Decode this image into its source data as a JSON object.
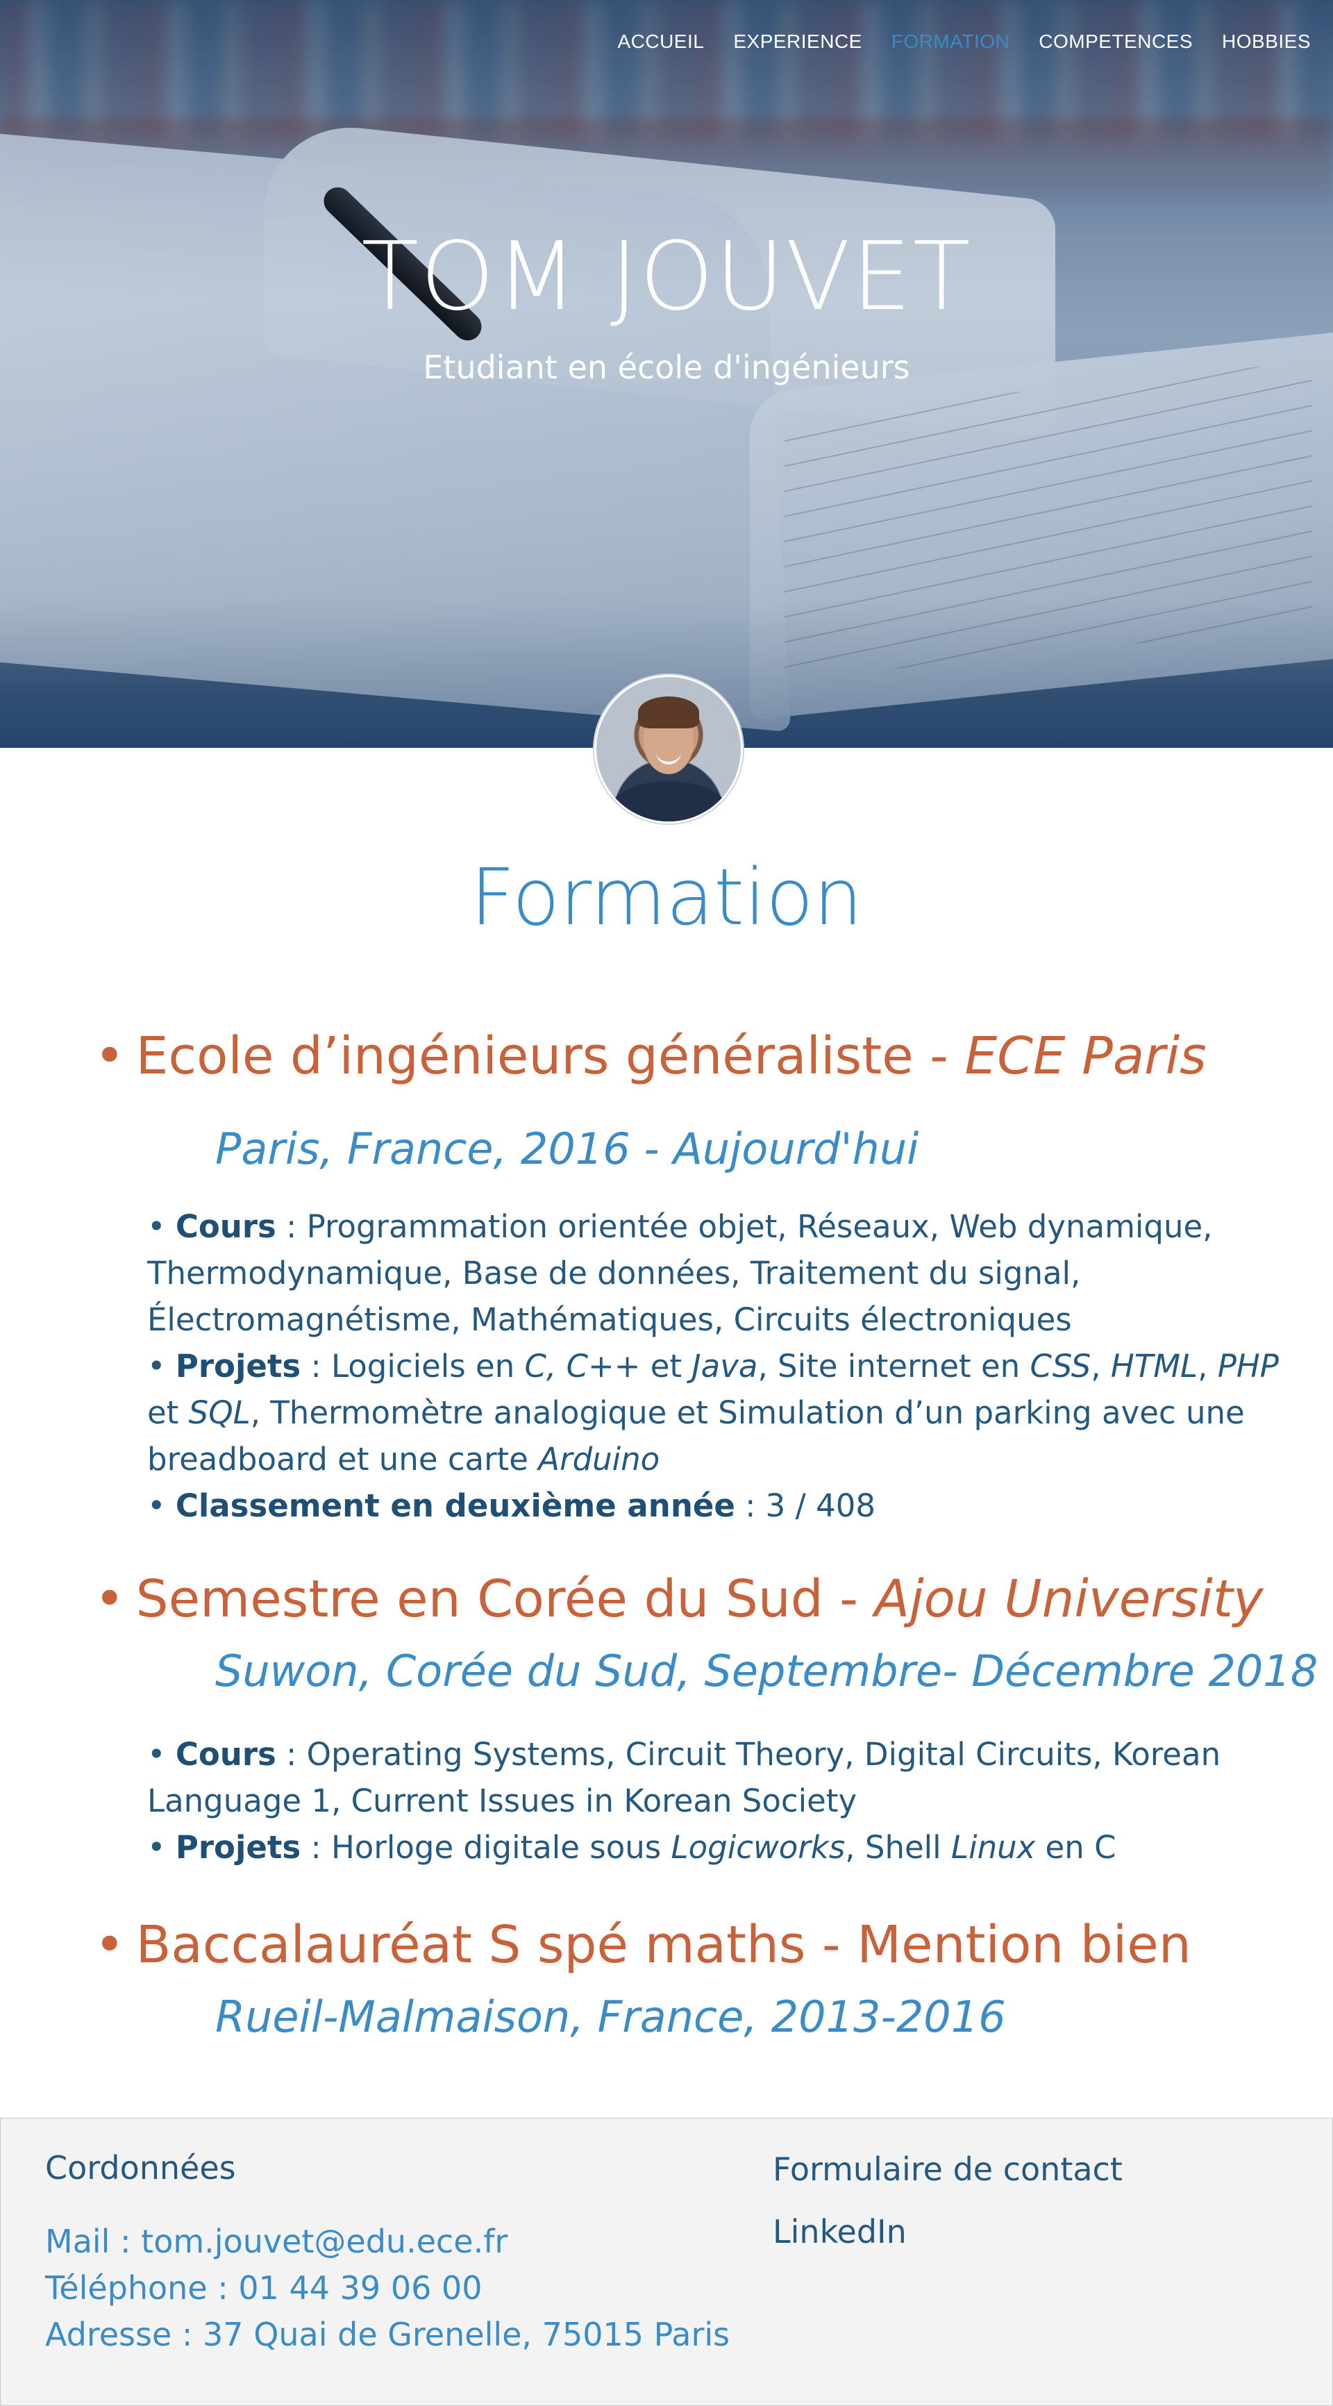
{
  "nav": {
    "items": [
      {
        "label": "ACCUEIL"
      },
      {
        "label": "EXPERIENCE"
      },
      {
        "label": "FORMATION",
        "active": true
      },
      {
        "label": "COMPETENCES"
      },
      {
        "label": "HOBBIES"
      }
    ]
  },
  "hero": {
    "name": "TOM JOUVET",
    "subtitle": "Etudiant en école d'ingénieurs"
  },
  "section": {
    "title": "Formation"
  },
  "entries": [
    {
      "bullet": "•",
      "title": "Ecole d’ingénieurs généraliste - ",
      "title_italic": "ECE Paris",
      "subtitle": "Paris, France, 2016 - Aujourd'hui",
      "details": [
        {
          "label": "Cours",
          "text": " : Programmation orientée objet, Réseaux, Web dynamique, Thermodynamique, Base de données, Traitement du signal, Électromagnétisme, Mathématiques, Circuits électroniques"
        },
        {
          "label": "Projets",
          "parts": [
            {
              "t": " : Logiciels en ",
              "i": false
            },
            {
              "t": "C, C++",
              "i": true
            },
            {
              "t": " et ",
              "i": false
            },
            {
              "t": "Java",
              "i": true
            },
            {
              "t": ", Site internet en ",
              "i": false
            },
            {
              "t": "CSS",
              "i": true
            },
            {
              "t": ", ",
              "i": false
            },
            {
              "t": "HTML",
              "i": true
            },
            {
              "t": ", ",
              "i": false
            },
            {
              "t": "PHP",
              "i": true
            },
            {
              "t": " et ",
              "i": false
            },
            {
              "t": "SQL",
              "i": true
            },
            {
              "t": ", Thermomètre analogique et Simulation d’un parking avec une breadboard et une carte ",
              "i": false
            },
            {
              "t": "Arduino",
              "i": true
            }
          ]
        },
        {
          "label": "Classement en deuxième année",
          "text": " : 3 / 408"
        }
      ]
    },
    {
      "bullet": "•",
      "title": "Semestre en Corée du Sud - ",
      "title_italic": "Ajou University",
      "subtitle": "Suwon, Corée du Sud, Septembre- Décembre 2018",
      "details": [
        {
          "label": "Cours",
          "text": " : Operating Systems, Circuit Theory, Digital Circuits, Korean Language 1, Current Issues in Korean Society"
        },
        {
          "label": "Projets",
          "parts": [
            {
              "t": " : Horloge digitale sous ",
              "i": false
            },
            {
              "t": "Logicworks",
              "i": true
            },
            {
              "t": ", Shell ",
              "i": false
            },
            {
              "t": "Linux",
              "i": true
            },
            {
              "t": " en C",
              "i": false
            }
          ]
        }
      ]
    },
    {
      "bullet": "•",
      "title": "Baccalauréat S spé maths - Mention bien",
      "title_italic": "",
      "subtitle": "Rueil-Malmaison, France, 2013-2016",
      "details": []
    }
  ],
  "footer": {
    "heading": "Cordonnées",
    "mail": "Mail : tom.jouvet@edu.ece.fr",
    "phone": "Téléphone : 01 44 39 06 00",
    "address": "Adresse : 37 Quai de Grenelle, 75015 Paris",
    "contact_form": "Formulaire de contact",
    "linkedin": "LinkedIn"
  },
  "colors": {
    "accent_blue": "#3a8bc6",
    "accent_orange": "#c8623a",
    "text_dark_blue": "#24587f",
    "footer_bg": "#f3f3f3"
  },
  "icons": {
    "bullet": "bullet-dot"
  }
}
